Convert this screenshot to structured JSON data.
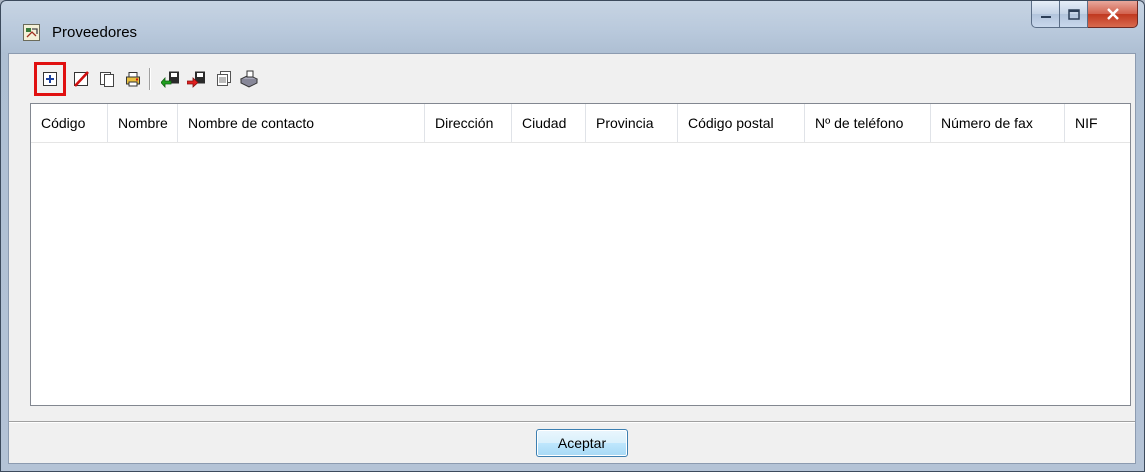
{
  "window": {
    "title": "Proveedores"
  },
  "toolbar": {
    "buttons": [
      {
        "icon": "add-row-icon"
      },
      {
        "icon": "delete-row-icon"
      },
      {
        "icon": "copy-icon"
      },
      {
        "icon": "print-icon"
      },
      {
        "icon": "import-icon"
      },
      {
        "icon": "export-icon"
      },
      {
        "icon": "copy-list-icon"
      },
      {
        "icon": "database-icon"
      }
    ]
  },
  "table": {
    "columns": [
      "Código",
      "Nombre",
      "Nombre de contacto",
      "Dirección",
      "Ciudad",
      "Provincia",
      "Código postal",
      "Nº de teléfono",
      "Número de fax",
      "NIF"
    ],
    "rows": []
  },
  "footer": {
    "ok_label": "Aceptar"
  },
  "colors": {
    "selected_highlight": "#e01010"
  }
}
